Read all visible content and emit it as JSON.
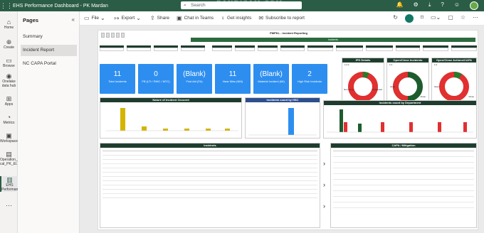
{
  "app": {
    "title": "EHS Performance Dashboard - PK Mardan",
    "search_placeholder": "Search",
    "watermark": "BANDICAM.COM",
    "brand_color": "#2b5c45",
    "accent_color": "#2d8ef0"
  },
  "left_nav": [
    {
      "label": "Home",
      "icon": "home-icon"
    },
    {
      "label": "Create",
      "icon": "plus-icon"
    },
    {
      "label": "Browse",
      "icon": "folder-icon"
    },
    {
      "label": "Onelake data hub",
      "icon": "hub-icon"
    },
    {
      "label": "Apps",
      "icon": "apps-icon"
    },
    {
      "label": "Metrics",
      "icon": "metrics-icon"
    },
    {
      "label": "Workspaces",
      "icon": "workspaces-icon"
    },
    {
      "label": "Operation_I cal_PK_El...",
      "icon": "workspace-icon"
    },
    {
      "label": "EHS Performan...",
      "icon": "report-icon"
    }
  ],
  "pages_panel": {
    "title": "Pages",
    "items": [
      "Summary",
      "Incident Report",
      "NC CAPA Portal"
    ],
    "active_index": 1
  },
  "toolbar": {
    "file": "File",
    "export": "Export",
    "share": "Share",
    "chat": "Chat in Teams",
    "insights": "Get insights",
    "subscribe": "Subscribe to report"
  },
  "report": {
    "title": "PMPKL - Incident Reporting",
    "subtitle": "Incidents",
    "kpis": [
      {
        "value": "11",
        "label": "Total Incidents"
      },
      {
        "value": "0",
        "label": "FB (LTI / RWC / MTC)"
      },
      {
        "value": "(Blank)",
        "label": "First Aid (FA)"
      },
      {
        "value": "11",
        "label": "Near Miss (NM)"
      },
      {
        "value": "(Blank)",
        "label": "Material Incident (MI)"
      },
      {
        "value": "2",
        "label": "High Risk Incidents"
      }
    ],
    "donuts": [
      {
        "title": "IPS Details",
        "left_label": "Not Comp.",
        "right_label": "Completed"
      },
      {
        "title": "Open/Close Incidents",
        "left_label": "Open",
        "right_label": "Close"
      },
      {
        "title": "Open/Close Actions/CAPA",
        "left_label": "Open",
        "right_label": "Close"
      }
    ],
    "charts": {
      "nature_title": "Nature of Incident Occured",
      "hsc_title": "Incidents count by HSC",
      "dept_title": "Incidents count by Department"
    },
    "tables": {
      "incidents_title": "Incidents",
      "capa_title": "CAPA / Mitigation"
    }
  }
}
